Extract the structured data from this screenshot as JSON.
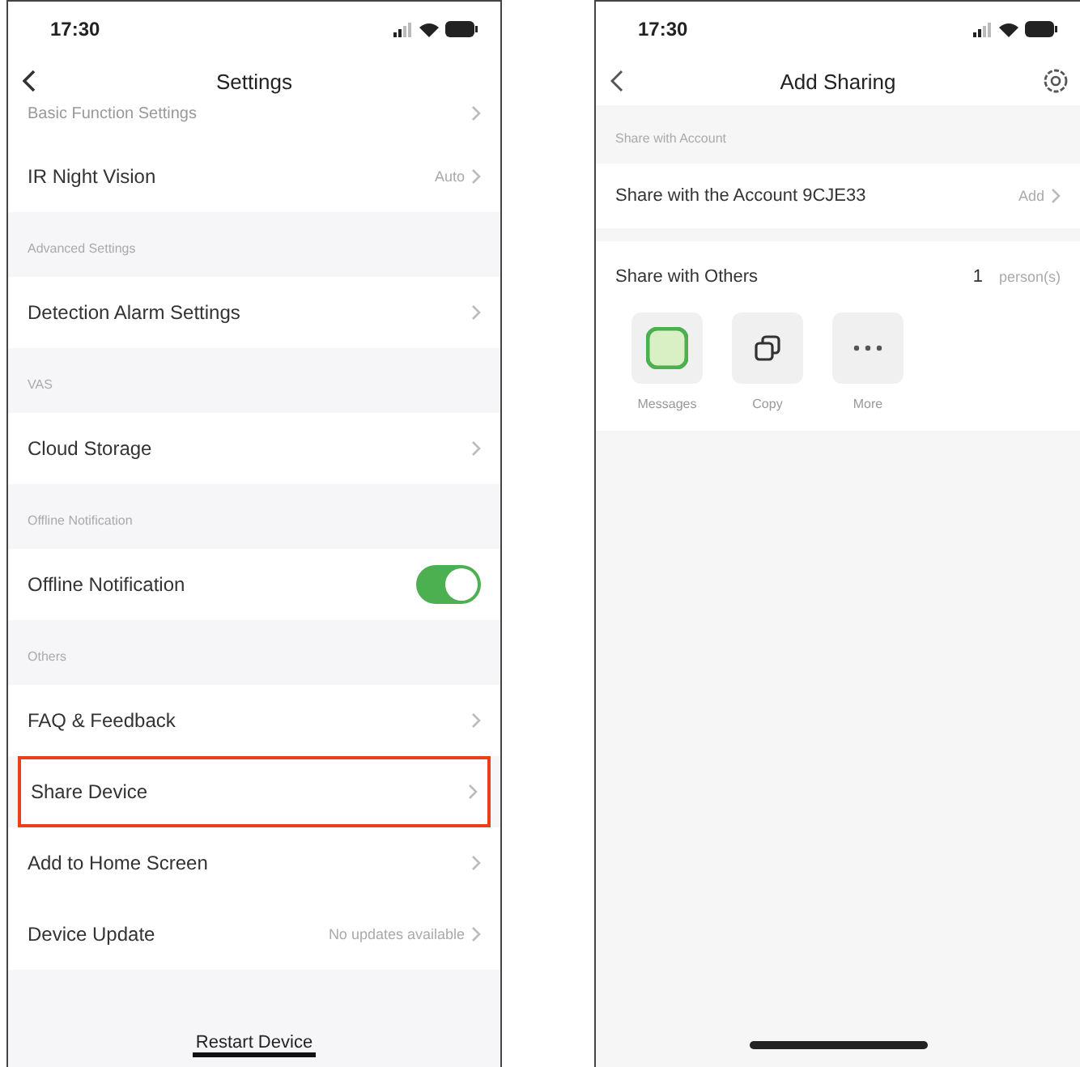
{
  "left_screen": {
    "status_bar": {
      "time": "17:30"
    },
    "nav": {
      "title": "Settings"
    },
    "items": [
      {
        "kind": "partial",
        "label": "Basic Function Settings"
      },
      {
        "kind": "row",
        "label": "IR Night Vision",
        "value": "Auto"
      },
      {
        "kind": "header",
        "label": "Advanced Settings"
      },
      {
        "kind": "row",
        "label": "Detection Alarm Settings"
      },
      {
        "kind": "header",
        "label": "VAS"
      },
      {
        "kind": "row",
        "label": "Cloud Storage"
      },
      {
        "kind": "header",
        "label": "Offline Notification"
      },
      {
        "kind": "toggle",
        "label": "Offline Notification",
        "on": true
      },
      {
        "kind": "header",
        "label": "Others"
      },
      {
        "kind": "row",
        "label": "FAQ & Feedback"
      },
      {
        "kind": "row",
        "label": "Share Device",
        "highlighted": true
      },
      {
        "kind": "row",
        "label": "Add to Home Screen"
      },
      {
        "kind": "row",
        "label": "Device Update",
        "value": "No updates available"
      }
    ],
    "footer_button": "Restart Device"
  },
  "right_screen": {
    "status_bar": {
      "time": "17:30"
    },
    "nav": {
      "title": "Add Sharing"
    },
    "section_header": "Share with Account",
    "account_row": {
      "label": "Share with the Account 9CJE33",
      "value": "Add"
    },
    "others_row": {
      "label": "Share with Others",
      "count": "1",
      "unit": "person(s)"
    },
    "share_options": [
      {
        "kind": "messages",
        "label": "Messages"
      },
      {
        "kind": "copy",
        "label": "Copy"
      },
      {
        "kind": "more",
        "label": "More"
      }
    ]
  }
}
